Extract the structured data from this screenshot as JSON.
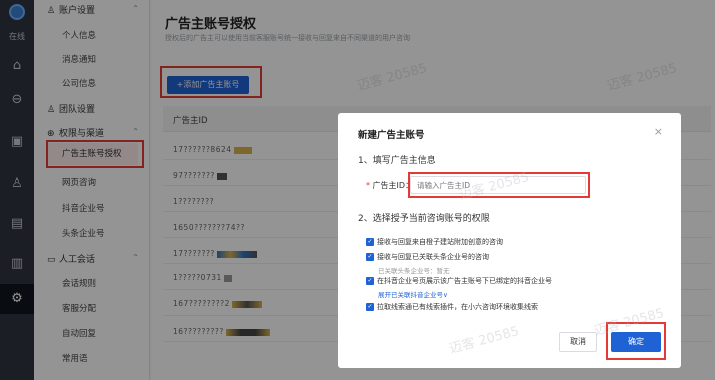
{
  "rail": {
    "status": "在线",
    "icons": [
      "home-icon",
      "compass-icon",
      "grid-icon",
      "user-icon",
      "document-icon",
      "bar-chart-icon",
      "settings-icon"
    ]
  },
  "nav": {
    "account_group": "账户设置",
    "personal_info": "个人信息",
    "notify": "消息通知",
    "company_info": "公司信息",
    "team_settings": "团队设置",
    "perm_group": "权限与渠道",
    "ad_auth": "广告主账号授权",
    "web_consult": "网页咨询",
    "douyin": "抖音企业号",
    "toutiao": "头条企业号",
    "ai_group": "人工会话",
    "session_rules": "会话规则",
    "guest_assign": "客服分配",
    "auto_reply": "自动回复",
    "common_words": "常用语"
  },
  "main": {
    "title": "广告主账号授权",
    "subtitle": "授权后的广告主可以使用当前客服账号统一接收与回复来自不同渠道的用户咨询",
    "add_button": "+添加广告主账号",
    "col_header": "广告主ID",
    "rows": [
      "17??????8624",
      "97???????",
      "1????????",
      "1650???????74??",
      "17???????",
      "1?????0731",
      "167????????2",
      "16?????????"
    ]
  },
  "watermark": "迈客 20585",
  "modal": {
    "title": "新建广告主账号",
    "close": "×",
    "section1": "1、填写广告主信息",
    "field_label": "广告主ID：",
    "field_required": "*",
    "field_placeholder": "请输入广告主ID",
    "section2": "2、选择授予当前咨询账号的权限",
    "opt1": "接收与回复来自橙子建站附加创意的咨询",
    "opt2": "接收与回复已关联头条企业号的咨询",
    "opt2_note": "已关联头条企业号：暂无",
    "opt3": "在抖音企业号页展示该广告主账号下已绑定的抖音企业号",
    "opt3_link": "展开已关联抖音企业号∨",
    "opt4": "拉取线索通已有线索插件，在小六咨询环境收集线索",
    "cancel": "取消",
    "confirm": "确定"
  }
}
